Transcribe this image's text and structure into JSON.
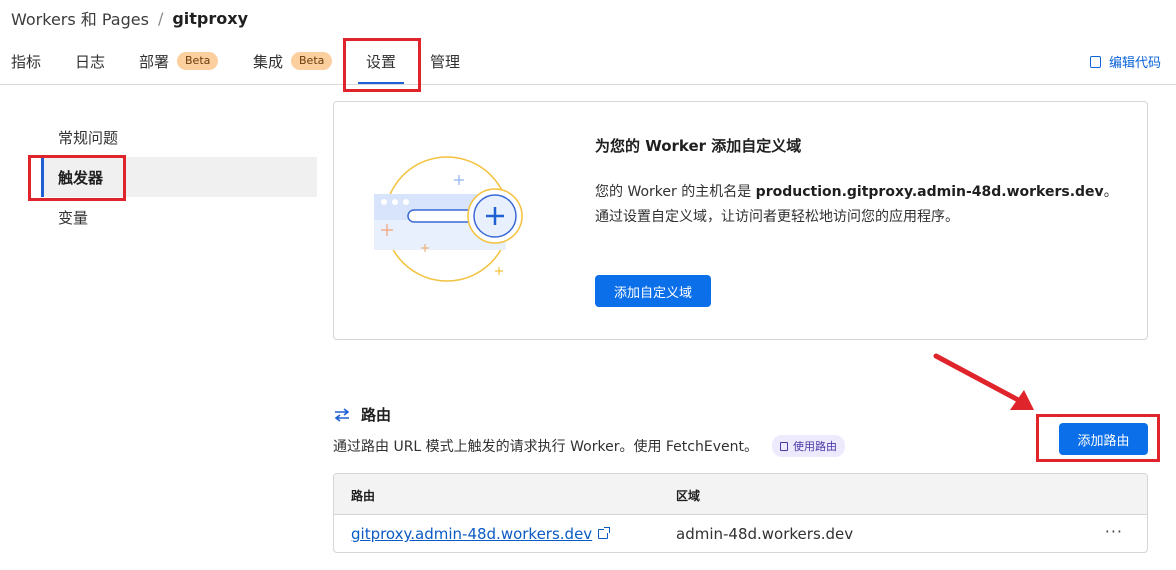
{
  "breadcrumb": {
    "parent": "Workers 和 Pages",
    "separator": "/",
    "current": "gitproxy"
  },
  "tabs": [
    {
      "label": "指标"
    },
    {
      "label": "日志"
    },
    {
      "label": "部署",
      "badge": "Beta"
    },
    {
      "label": "集成",
      "badge": "Beta"
    },
    {
      "label": "设置",
      "active": true
    },
    {
      "label": "管理"
    }
  ],
  "edit_code": "编辑代码",
  "sidenav": {
    "items": [
      {
        "label": "常规问题"
      },
      {
        "label": "触发器",
        "active": true
      },
      {
        "label": "变量"
      }
    ]
  },
  "domain_card": {
    "title": "为您的 Worker 添加自定义域",
    "desc_prefix": "您的 Worker 的主机名是 ",
    "hostname": "production.gitproxy.admin-48d.workers.dev",
    "desc_suffix": "。通过设置自定义域，让访问者更轻松地访问您的应用程序。",
    "button": "添加自定义域"
  },
  "routes": {
    "title": "路由",
    "description": "通过路由 URL 模式上触发的请求执行 Worker。使用 FetchEvent。",
    "use_routes": "使用路由",
    "add_button": "添加路由",
    "columns": [
      "路由",
      "区域"
    ],
    "rows": [
      {
        "route": "gitproxy.admin-48d.workers.dev",
        "zone": "admin-48d.workers.dev"
      }
    ],
    "more": "···"
  },
  "colors": {
    "accent": "#0a6fe8",
    "highlight": "#e0242b",
    "badge": "#fbcf9e"
  }
}
